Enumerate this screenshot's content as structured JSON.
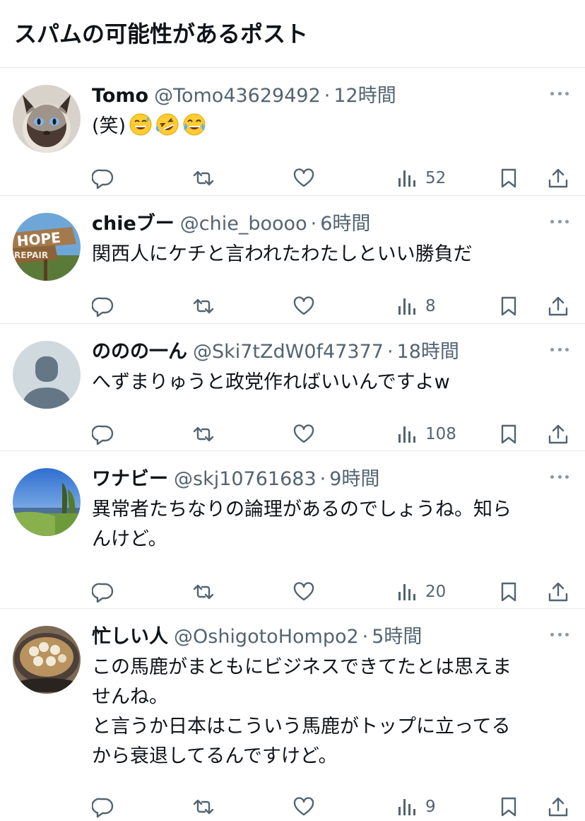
{
  "header": {
    "title": "スパムの可能性があるポスト"
  },
  "posts": [
    {
      "name": "Tomo",
      "handle": "@Tomo43629492",
      "dot": "·",
      "time": "12時間",
      "lines": [
        "(笑)"
      ],
      "emojis": [
        "grinning-sweat-emoji",
        "rolling-laughing-emoji",
        "tears-of-joy-emoji"
      ],
      "views": "52",
      "avatar": "siamese-cat-photo"
    },
    {
      "name": "chieブー",
      "handle": "@chie_boooo",
      "dot": "·",
      "time": "6時間",
      "lines": [
        "関西人にケチと言われたわたしといい勝負だ"
      ],
      "views": "8",
      "avatar": "hope-repair-sign-photo"
    },
    {
      "name": "ののの一ん",
      "handle": "@Ski7tZdW0f47377",
      "dot": "·",
      "time": "18時間",
      "lines": [
        "へずまりゅうと政党作ればいいんですよw"
      ],
      "views": "108",
      "avatar": "default-profile"
    },
    {
      "name": "ワナビー",
      "handle": "@skj10761683",
      "dot": "·",
      "time": "9時間",
      "lines": [
        "異常者たちなりの論理があるのでしょうね。知ら",
        "んけど。"
      ],
      "views": "20",
      "avatar": "landscape-sky-photo"
    },
    {
      "name": "忙しい人",
      "handle": "@OshigotoHompo2",
      "dot": "·",
      "time": "5時間",
      "lines": [
        "この馬鹿がまともにビジネスできてたとは思えま",
        "せんね。",
        "と言うか日本はこういう馬鹿がトップに立ってる",
        "から衰退してるんですけど。"
      ],
      "views": "9",
      "avatar": "food-bowl-photo"
    }
  ],
  "colors": {
    "text": "#0f1419",
    "secondary": "#536471",
    "divider": "#e7e9ea",
    "icon": "#536471"
  }
}
